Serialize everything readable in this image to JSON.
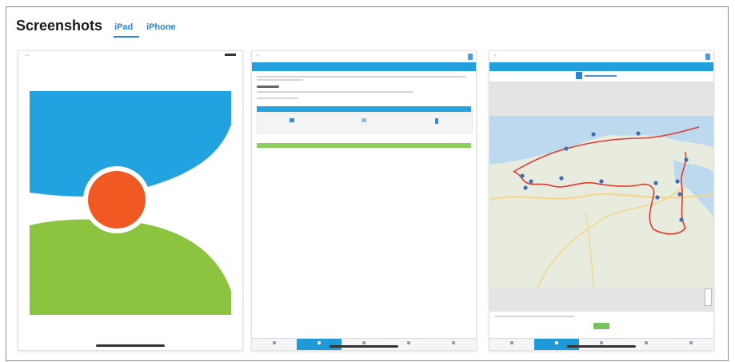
{
  "header": {
    "title": "Screenshots",
    "tabs": [
      "iPad",
      "iPhone"
    ],
    "selected_tab": "iPad"
  },
  "colors": {
    "tab_accent": "#2a86d5",
    "logo_blue": "#22a3e0",
    "logo_green": "#8cc43f",
    "logo_orange": "#f05a22",
    "ui_blue": "#22a0dc",
    "route_red": "#e03a2f"
  },
  "screenshots": [
    {
      "content": "app-logo"
    },
    {
      "content": "form-screen"
    },
    {
      "content": "map-screen"
    }
  ]
}
